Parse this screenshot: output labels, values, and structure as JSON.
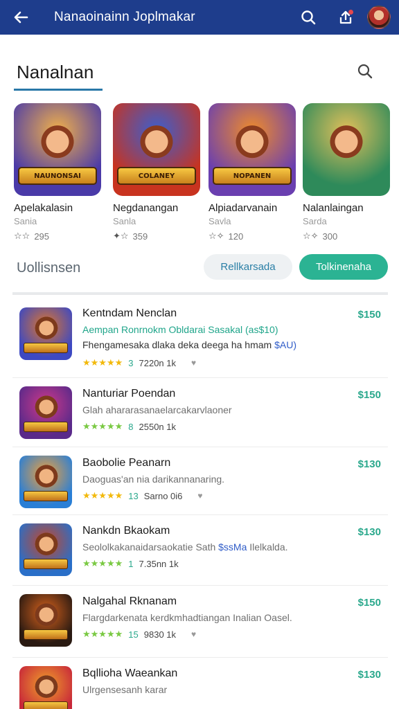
{
  "appbar": {
    "title": "Nanaoinainn Joplmakar",
    "color": "#1e3d8c"
  },
  "section": {
    "title": "Nanalnan"
  },
  "featured": [
    {
      "logo": "NAUNONSAI",
      "name": "Apelakalasin",
      "sub": "Sania",
      "glyph": "☆☆",
      "count": "295",
      "bg": "#4a3aa8",
      "bg2": "#f2b14a"
    },
    {
      "logo": "COLANEY",
      "name": "Negdanangan",
      "sub": "Sanla",
      "glyph": "✦☆",
      "count": "359",
      "bg": "#c8331f",
      "bg2": "#3a5fd0"
    },
    {
      "logo": "NOPANEN",
      "name": "Alpiadarvanain",
      "sub": "Savla",
      "glyph": "☆✧",
      "count": "120",
      "bg": "#6a3fb0",
      "bg2": "#f08c2a"
    },
    {
      "logo": "",
      "name": "Nalanlaingan",
      "sub": "Sarda",
      "glyph": "☆✧",
      "count": "300",
      "bg": "#2e8a5a",
      "bg2": "#e2c05a"
    }
  ],
  "filters": {
    "label": "Uollisnsen",
    "chip_outline": "Rellkarsada",
    "chip_solid": "Tolkinenaha"
  },
  "list": [
    {
      "title": "Kentndam Nenclan",
      "line1": "Aempan Ronrnokm Obldarai Sasakal (as$10)",
      "line1_accent": true,
      "line2a": "Fhengamesaka dlaka deka deega ha hmam",
      "line2b": "$AU)",
      "stars": "★★★★★",
      "stars_color": "gold",
      "rating": "3",
      "extra": "7220n 1k",
      "heart": "♥",
      "price": "$150",
      "icon_bg": "#3d49c2",
      "icon_bg2": "#e0762a"
    },
    {
      "title": "Nanturiar Poendan",
      "line1": "Glah ahararasanaelarcakarvlaoner",
      "line1_accent": false,
      "line2a": "",
      "line2b": "",
      "stars": "★★★★★",
      "stars_color": "green",
      "rating": "8",
      "extra": "2550n 1k",
      "heart": "",
      "price": "$150",
      "icon_bg": "#5a2a8a",
      "icon_bg2": "#d0398a"
    },
    {
      "title": "Baobolie Peanarn",
      "line1": "Daoguas'an nia darikannanaring.",
      "line1_accent": false,
      "line2a": "",
      "line2b": "",
      "stars": "★★★★★",
      "stars_color": "gold",
      "rating": "13",
      "extra": "Sarno 0i6",
      "heart": "♥",
      "price": "$130",
      "icon_bg": "#2a7fd6",
      "icon_bg2": "#f2a13a"
    },
    {
      "title": "Nankdn Bkaokam",
      "line1a": "Seololkakanaidarsaokatie Sath",
      "line1b": "$ssMa",
      "line1c": "Ilelkalda.",
      "stars": "★★★★★",
      "stars_color": "green",
      "rating": "1",
      "extra": "7.35nn 1k",
      "heart": "",
      "price": "$130",
      "icon_bg": "#2a6fc8",
      "icon_bg2": "#c5462a"
    },
    {
      "title": "Nalgahal Rknanam",
      "line1": "Flargdarkenata kerdkmhadtiangan Inalian Oasel.",
      "line1_accent": false,
      "line2a": "",
      "line2b": "",
      "stars": "★★★★★",
      "stars_color": "green",
      "rating": "15",
      "extra": "9830 1k",
      "heart": "♥",
      "price": "$150",
      "icon_bg": "#2a1a12",
      "icon_bg2": "#d8621c"
    },
    {
      "title": "Bqllioha Waeankan",
      "line1": "Ulrgensesanh karar",
      "line1_accent": false,
      "line2a": "",
      "line2b": "",
      "stars": "",
      "stars_color": "gold",
      "rating": "",
      "extra": "",
      "heart": "",
      "price": "$130",
      "icon_bg": "#c8283a",
      "icon_bg2": "#f0a12a"
    }
  ]
}
